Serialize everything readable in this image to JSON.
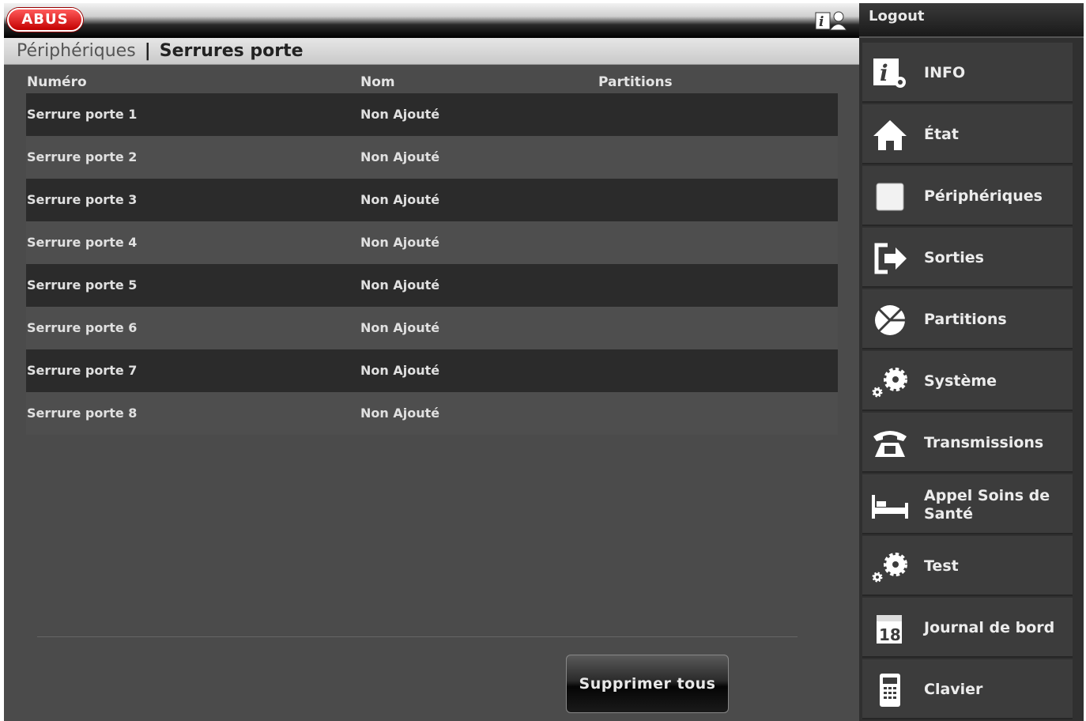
{
  "header": {
    "logo_text": "ABUS",
    "logout_label": "Logout"
  },
  "breadcrumb": {
    "parent": "Périphériques",
    "separator": "|",
    "current": "Serrures porte"
  },
  "table": {
    "columns": [
      "Numéro",
      "Nom",
      "Partitions"
    ],
    "rows": [
      {
        "numero": "Serrure porte 1",
        "nom": "Non Ajouté",
        "partitions": ""
      },
      {
        "numero": "Serrure porte 2",
        "nom": "Non Ajouté",
        "partitions": ""
      },
      {
        "numero": "Serrure porte 3",
        "nom": "Non Ajouté",
        "partitions": ""
      },
      {
        "numero": "Serrure porte 4",
        "nom": "Non Ajouté",
        "partitions": ""
      },
      {
        "numero": "Serrure porte 5",
        "nom": "Non Ajouté",
        "partitions": ""
      },
      {
        "numero": "Serrure porte 6",
        "nom": "Non Ajouté",
        "partitions": ""
      },
      {
        "numero": "Serrure porte 7",
        "nom": "Non Ajouté",
        "partitions": ""
      },
      {
        "numero": "Serrure porte 8",
        "nom": "Non Ajouté",
        "partitions": ""
      }
    ]
  },
  "actions": {
    "delete_all_label": "Supprimer tous"
  },
  "sidebar": {
    "items": [
      {
        "label": "INFO",
        "icon": "info-settings-icon"
      },
      {
        "label": "État",
        "icon": "home-icon"
      },
      {
        "label": "Périphériques",
        "icon": "device-square-icon"
      },
      {
        "label": "Sorties",
        "icon": "exit-arrow-icon"
      },
      {
        "label": "Partitions",
        "icon": "partition-pie-icon"
      },
      {
        "label": "Système",
        "icon": "gears-icon"
      },
      {
        "label": "Transmissions",
        "icon": "telephone-icon"
      },
      {
        "label": "Appel Soins de Santé",
        "icon": "bed-icon"
      },
      {
        "label": "Test",
        "icon": "gears-icon"
      },
      {
        "label": "Journal de bord",
        "icon": "calendar-icon",
        "icon_text": "18"
      },
      {
        "label": "Clavier",
        "icon": "keypad-icon"
      }
    ]
  },
  "colors": {
    "background": "#4b4b4b",
    "row_dark": "#2b2b2b",
    "sidebar": "#303030",
    "logo_red": "#c30000",
    "text": "#e0e0e0"
  }
}
